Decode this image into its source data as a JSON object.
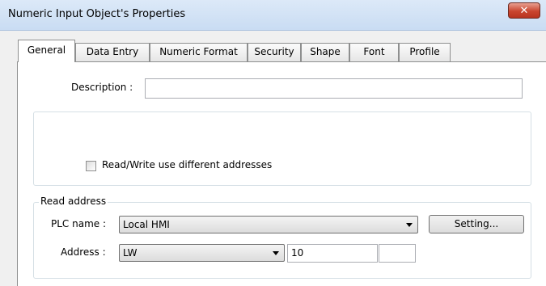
{
  "window": {
    "title": "Numeric Input Object's Properties",
    "close_glyph": "✕"
  },
  "tabs": [
    {
      "label": "General",
      "active": true
    },
    {
      "label": "Data Entry"
    },
    {
      "label": "Numeric Format"
    },
    {
      "label": "Security"
    },
    {
      "label": "Shape"
    },
    {
      "label": "Font"
    },
    {
      "label": "Profile"
    }
  ],
  "general": {
    "description_label": "Description :",
    "description_value": "",
    "rw_checkbox_label": "Read/Write use different addresses",
    "rw_checkbox_checked": false
  },
  "read_address": {
    "group_label": "Read address",
    "plc_label": "PLC name :",
    "plc_value": "Local HMI",
    "setting_button": "Setting...",
    "address_label": "Address :",
    "address_type": "LW",
    "address_value": "10",
    "extra_value": ""
  }
}
